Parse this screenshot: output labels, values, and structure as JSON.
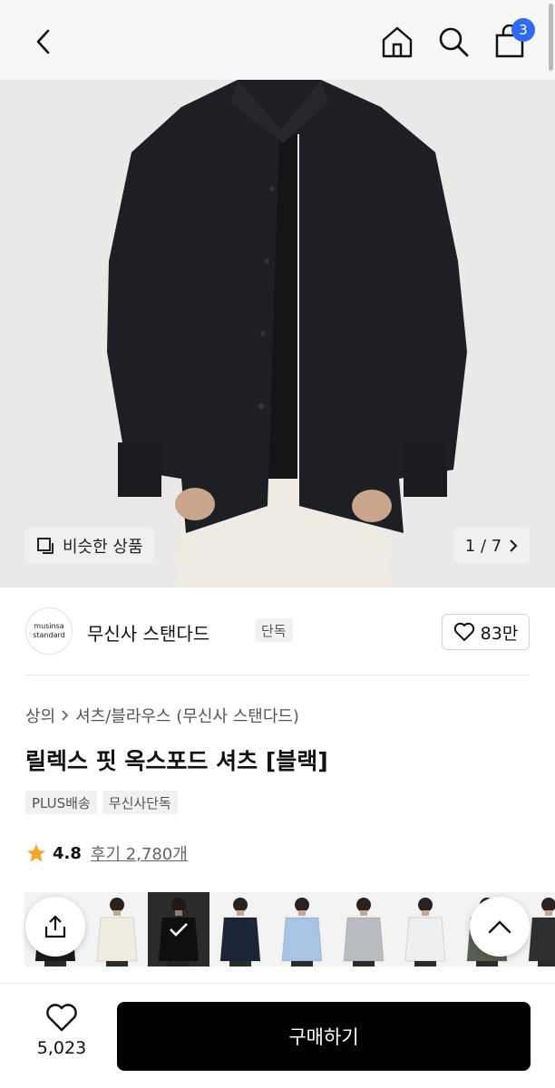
{
  "header": {
    "cart_count": "3",
    "icons": [
      "back-icon",
      "home-icon",
      "search-icon",
      "cart-icon"
    ]
  },
  "hero": {
    "similar_label": "비슷한 상품",
    "pager": "1 / 7"
  },
  "brand": {
    "logo_line1": "musinsa",
    "logo_line2": "standard",
    "name": "무신사 스탠다드",
    "tag": "단독",
    "likes": "83만"
  },
  "product": {
    "breadcrumb": [
      "상의",
      "셔츠/블라우스 (무신사 스탠다드)"
    ],
    "title": "릴렉스 핏 옥스포드 셔츠 [블랙]",
    "tags": [
      "PLUS배송",
      "무신사단독"
    ],
    "rating": "4.8",
    "reviews": "후기 2,780개"
  },
  "colors": {
    "selected_index": 2,
    "swatches": [
      "#1b1b1d",
      "#f1ece0",
      "#141414",
      "#1c2537",
      "#a9c3e4",
      "#b9bcc0",
      "#efefef",
      "#596052",
      "#2e2f31"
    ]
  },
  "bottom": {
    "wish_count": "5,023",
    "buy_label": "구매하기"
  }
}
